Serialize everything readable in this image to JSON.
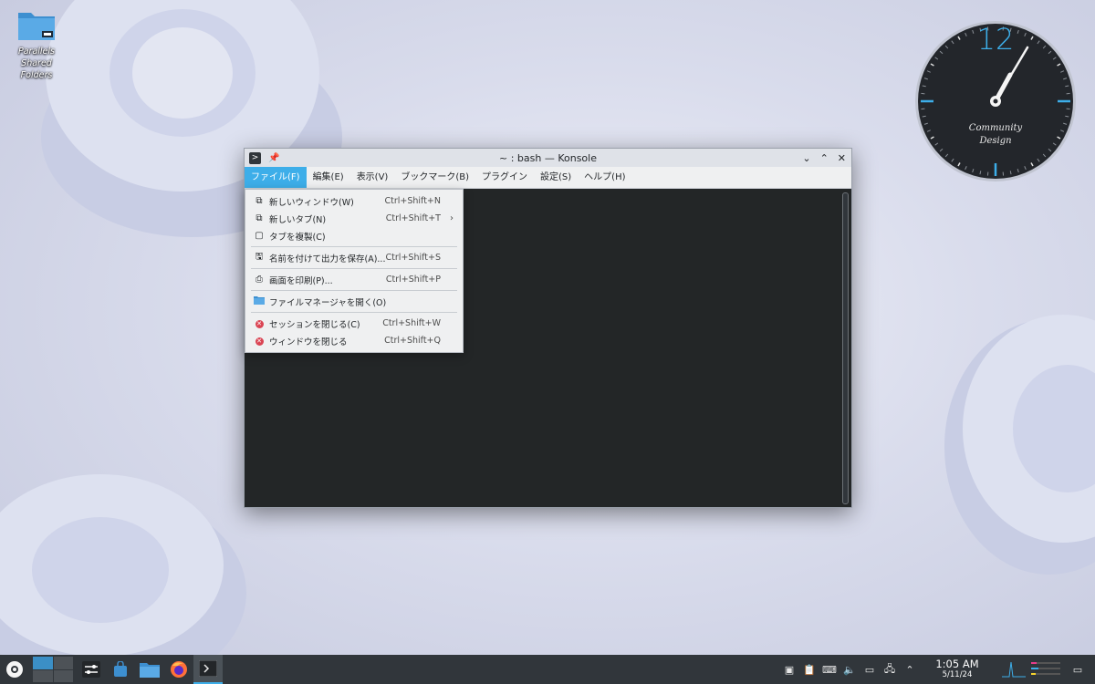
{
  "desktop": {
    "icon_label_line1": "Parallels Shared",
    "icon_label_line2": "Folders"
  },
  "clock_widget": {
    "twelve": "12",
    "line1": "Community",
    "line2": "Design"
  },
  "window": {
    "title": "~ : bash — Konsole",
    "menu": [
      "ファイル(F)",
      "編集(E)",
      "表示(V)",
      "ブックマーク(B)",
      "プラグイン",
      "設定(S)",
      "ヘルプ(H)"
    ],
    "active_menu_index": 0
  },
  "file_menu": {
    "items": [
      {
        "icon": "new-window-icon",
        "label": "新しいウィンドウ(W)",
        "shortcut": "Ctrl+Shift+N"
      },
      {
        "icon": "new-tab-icon",
        "label": "新しいタブ(N)",
        "shortcut": "Ctrl+Shift+T",
        "submenu": true
      },
      {
        "icon": "clone-tab-icon",
        "label": "タブを複製(C)",
        "shortcut": ""
      },
      {
        "icon": "save-icon",
        "label": "名前を付けて出力を保存(A)...",
        "shortcut": "Ctrl+Shift+S"
      },
      {
        "icon": "print-icon",
        "label": "画面を印刷(P)...",
        "shortcut": "Ctrl+Shift+P"
      },
      {
        "icon": "folder-icon",
        "label": "ファイルマネージャを開く(O)",
        "shortcut": ""
      },
      {
        "icon": "close-session-icon",
        "label": "セッションを閉じる(C)",
        "shortcut": "Ctrl+Shift+W"
      },
      {
        "icon": "close-window-icon",
        "label": "ウィンドウを閉じる",
        "shortcut": "Ctrl+Shift+Q"
      }
    ]
  },
  "taskbar": {
    "time": "1:05 AM",
    "date": "5/11/24"
  },
  "colors": {
    "accent": "#3daee9",
    "panel": "#31363b",
    "terminal_bg": "#232627",
    "menu_bg": "#eff0f1"
  }
}
